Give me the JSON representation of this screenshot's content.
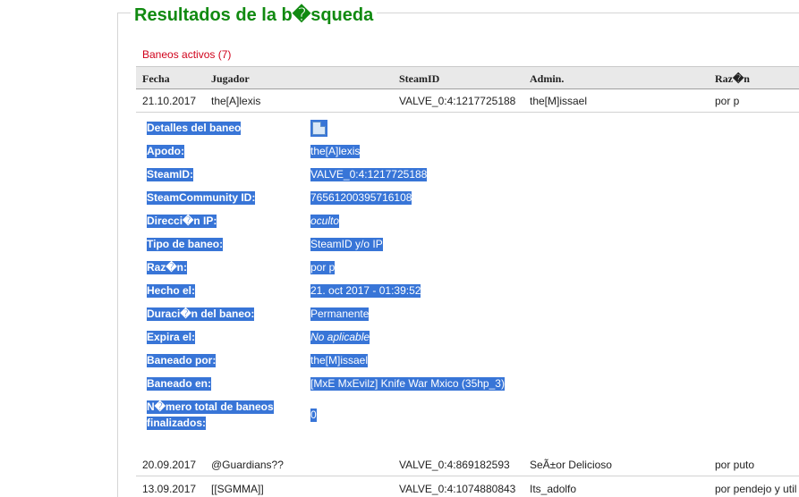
{
  "page": {
    "title": "Resultados de la b�squeda",
    "section_title": "Baneos activos (7)"
  },
  "table": {
    "headers": {
      "fecha": "Fecha",
      "jugador": "Jugador",
      "steamid": "SteamID",
      "admin": "Admin.",
      "razon": "Raz�n"
    },
    "rows": [
      {
        "fecha": "21.10.2017",
        "jugador": "the[A]lexis",
        "steamid": "VALVE_0:4:1217725188",
        "admin": "the[M]issael",
        "razon": "por p"
      },
      {
        "fecha": "20.09.2017",
        "jugador": "@Guardians??",
        "steamid": "VALVE_0:4:869182593",
        "admin": "SeÃ±or Delicioso",
        "razon": "por puto"
      },
      {
        "fecha": "13.09.2017",
        "jugador": "[[SGMMA]]",
        "steamid": "VALVE_0:4:1074880843",
        "admin": "Its_adolfo",
        "razon": "por pendejo y util"
      }
    ]
  },
  "details": {
    "icon": "document-icon",
    "labels": {
      "detalles": "Detalles del baneo",
      "apodo": "Apodo:",
      "steamid": "SteamID:",
      "community": "SteamCommunity ID:",
      "ip": "Direcci�n IP:",
      "tipo": "Tipo de baneo:",
      "razon": "Raz�n:",
      "hecho": "Hecho el:",
      "duracion": "Duraci�n del baneo:",
      "expira": "Expira el:",
      "baneado_por": "Baneado por:",
      "baneado_en": "Baneado en:",
      "total_line1": "N�mero total de baneos",
      "total_line2": "finalizados:"
    },
    "values": {
      "apodo": "the[A]lexis",
      "steamid": "VALVE_0:4:1217725188",
      "community": "76561200395716108",
      "ip": "oculto",
      "tipo": "SteamID y/o IP",
      "razon": "por p",
      "hecho": "21. oct 2017 - 01:39:52",
      "duracion": "Permanente",
      "expira": "No aplicable",
      "baneado_por": "the[M]issael",
      "baneado_en": "[MxE MxEvilz] Knife War Mxico (35hp_3)",
      "total": "0"
    }
  }
}
